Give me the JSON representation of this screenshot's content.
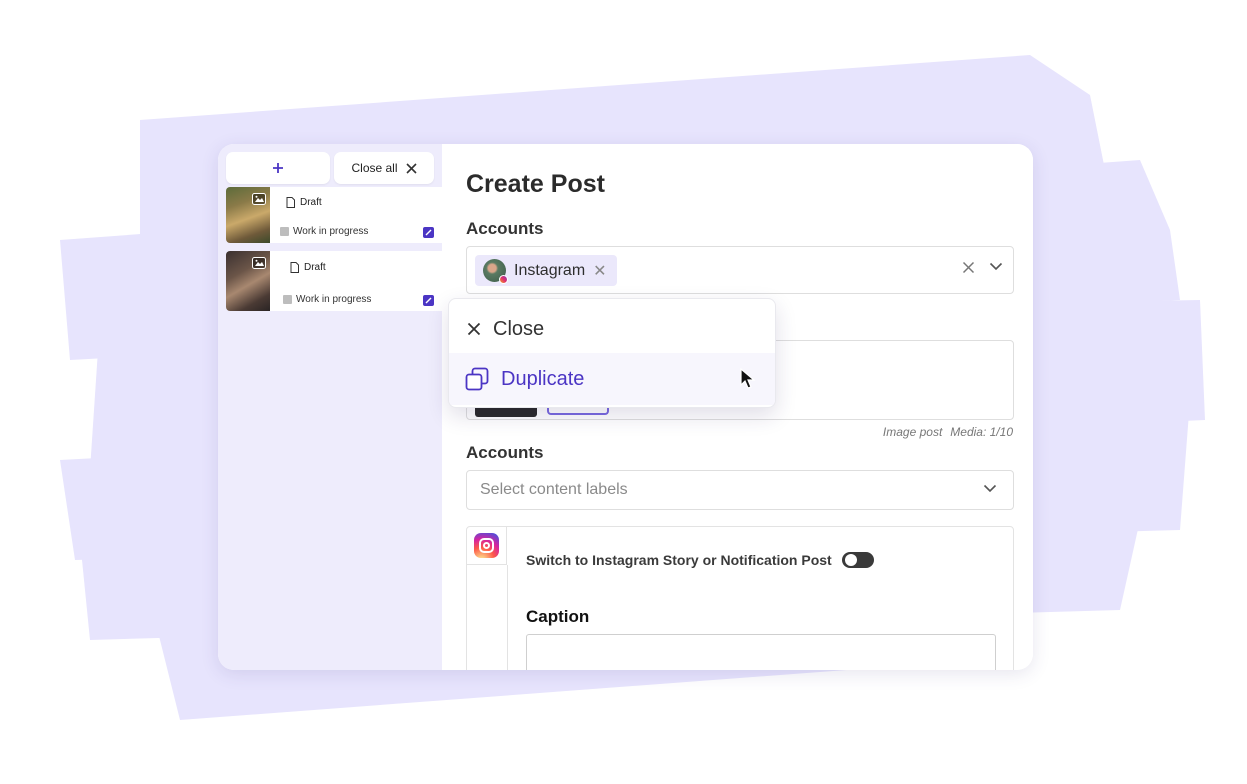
{
  "sidebar": {
    "new_button_icon": "plus-icon",
    "close_all_label": "Close all",
    "drafts": [
      {
        "tag": "Draft",
        "status": "Work in progress"
      },
      {
        "tag": "Draft",
        "status": "Work in progress"
      }
    ]
  },
  "main": {
    "title": "Create Post",
    "accounts_label": "Accounts",
    "account_chip": "Instagram",
    "media_type": "Image post",
    "media_count": "Media: 1/10",
    "labels_section_label": "Accounts",
    "labels_placeholder": "Select content labels",
    "switch_label": "Switch to Instagram Story or Notification Post",
    "caption_label": "Caption"
  },
  "menu": {
    "close_label": "Close",
    "duplicate_label": "Duplicate"
  },
  "colors": {
    "accent": "#4b35c4",
    "sidebar_bg": "#eeecfc",
    "backdrop": "#e6e3fc"
  }
}
